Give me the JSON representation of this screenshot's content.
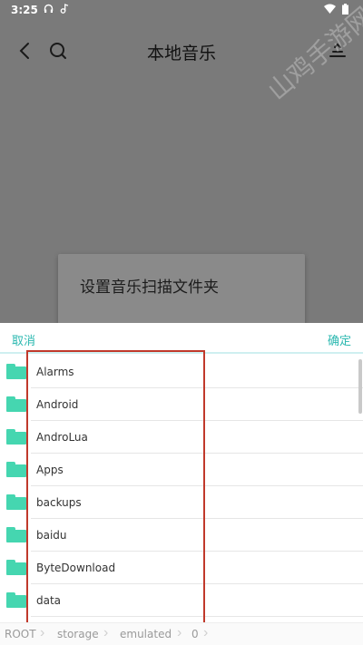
{
  "status_bar": {
    "time": "3:25"
  },
  "toolbar": {
    "title": "本地音乐"
  },
  "watermark": {
    "text": "山鸡手游网"
  },
  "background_dialog": {
    "title": "设置音乐扫描文件夹"
  },
  "sheet": {
    "cancel_label": "取消",
    "confirm_label": "确定",
    "folders": [
      "Alarms",
      "Android",
      "AndroLua",
      "Apps",
      "backups",
      "baidu",
      "ByteDownload",
      "data"
    ]
  },
  "breadcrumb": {
    "items": [
      "ROOT",
      "storage",
      "emulated",
      "0"
    ]
  },
  "colors": {
    "accent": "#2bb8b0",
    "folder": "#45d6b0",
    "highlight": "#c0392b"
  }
}
